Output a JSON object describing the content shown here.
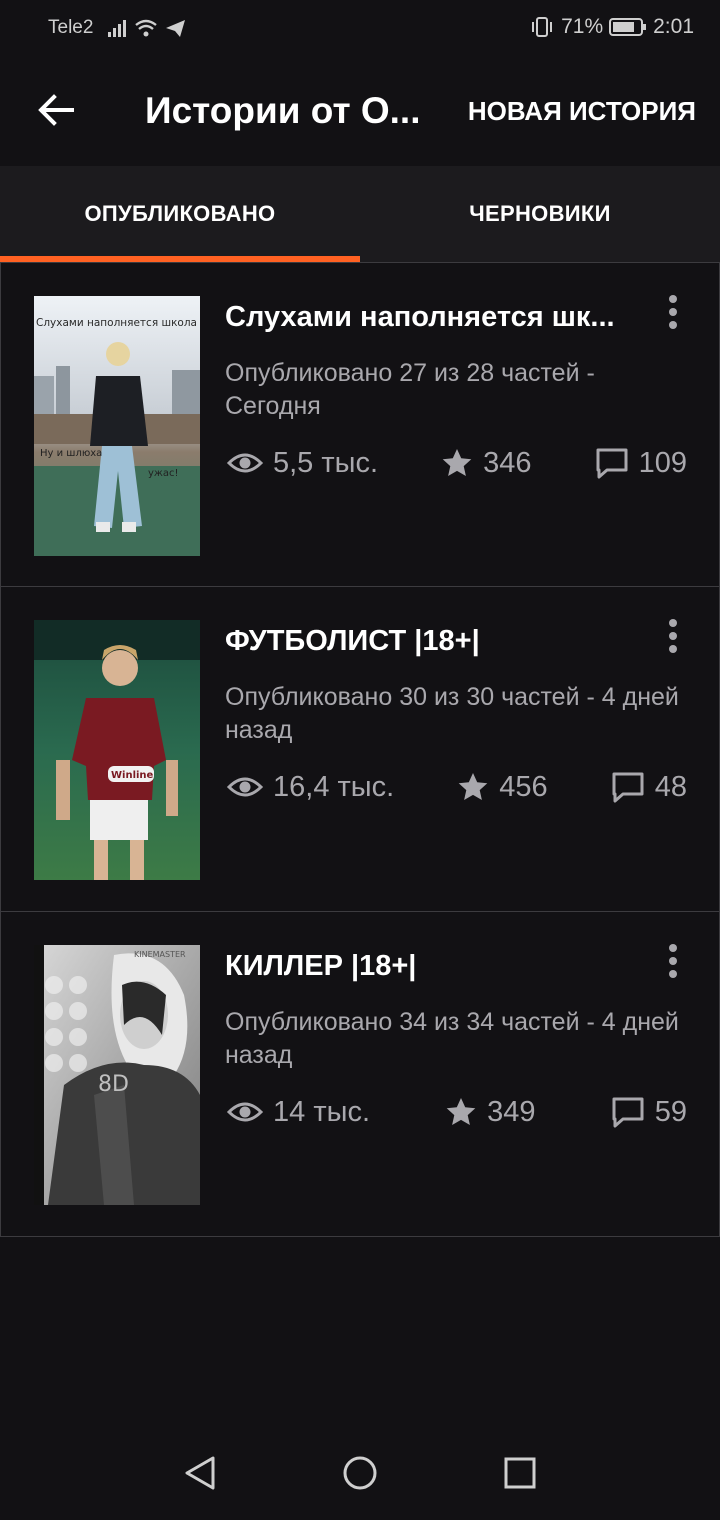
{
  "status_bar": {
    "carrier": "Tele2",
    "battery": "71%",
    "time": "2:01"
  },
  "app_bar": {
    "title": "Истории от О...",
    "new_story_label": "НОВАЯ ИСТОРИЯ"
  },
  "tabs": [
    {
      "label": "ОПУБЛИКОВАНО",
      "active": true
    },
    {
      "label": "ЧЕРНОВИКИ",
      "active": false
    }
  ],
  "stories": [
    {
      "title": "Слухами наполняется шк...",
      "meta": "Опубликовано 27 из 28 частей - Сегодня",
      "views": "5,5 тыс.",
      "stars": "346",
      "comments": "109",
      "cover_texts": [
        "Слухами наполняется школа",
        "Ну и шлюха",
        "ужас!"
      ]
    },
    {
      "title": "ФУТБОЛИСТ |18+|",
      "meta": "Опубликовано 30 из 30 частей - 4 дней назад",
      "views": "16,4 тыс.",
      "stars": "456",
      "comments": "48",
      "cover_texts": [
        "Winline"
      ]
    },
    {
      "title": "КИЛЛЕР |18+|",
      "meta": "Опубликовано 34 из 34 частей - 4 дней назад",
      "views": "14 тыс.",
      "stars": "349",
      "comments": "59",
      "cover_texts": [
        "KINEMASTER",
        "8D"
      ]
    }
  ],
  "colors": {
    "background": "#121114",
    "tab_bar": "#1c1b1e",
    "accent": "#ff6122",
    "secondary_text": "#a9a8ad"
  },
  "icons": [
    "back-arrow-icon",
    "eye-icon",
    "star-icon",
    "comment-icon",
    "more-vertical-icon",
    "nav-back-icon",
    "nav-home-icon",
    "nav-recents-icon"
  ]
}
